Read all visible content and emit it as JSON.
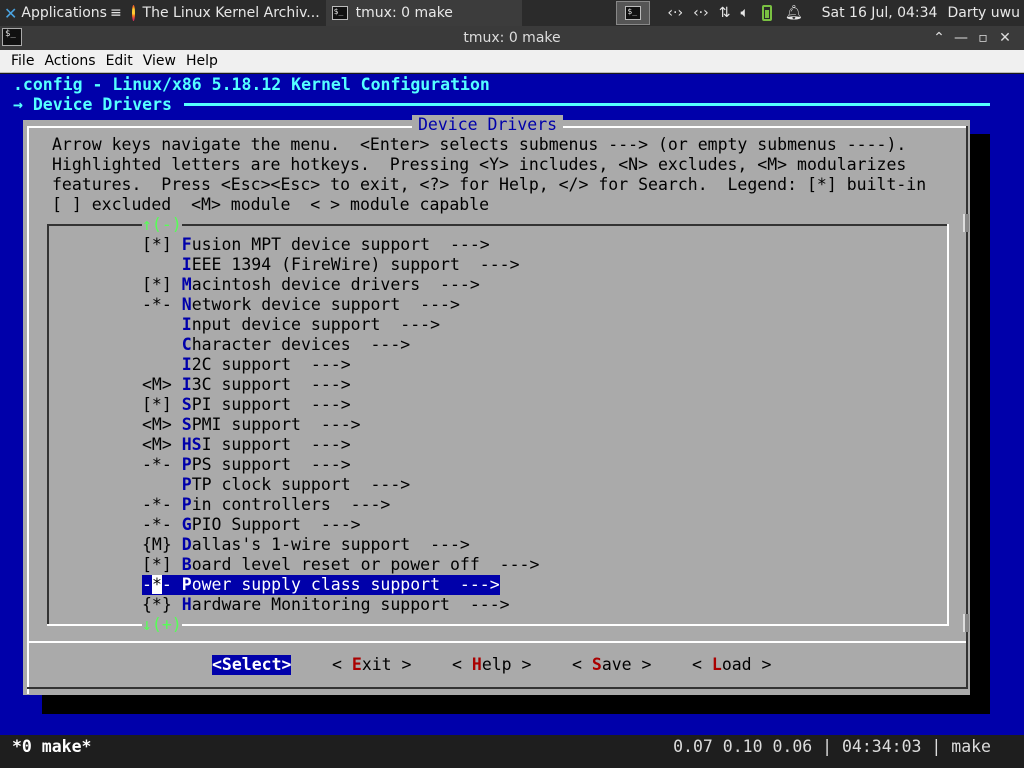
{
  "panel": {
    "apps_label": "Applications",
    "apps_suffix": "≡",
    "tasks": [
      {
        "label": "The Linux Kernel Archiv...",
        "icon": "firefox-icon"
      },
      {
        "label": "tmux: 0 make",
        "icon": "terminal-icon"
      }
    ],
    "clock": "Sat 16 Jul, 04:34",
    "user": "Darty uwu"
  },
  "window": {
    "title": "tmux: 0 make"
  },
  "menubar": {
    "items": [
      "File",
      "Actions",
      "Edit",
      "View",
      "Help"
    ]
  },
  "terminal": {
    "header_title": ".config - Linux/x86 5.18.12 Kernel Configuration",
    "breadcrumb": "→ Device Drivers",
    "dialog_title": "Device Drivers",
    "help_lines": [
      "Arrow keys navigate the menu.  <Enter> selects submenus ---> (or empty submenus ----).",
      "Highlighted letters are hotkeys.  Pressing <Y> includes, <N> excludes, <M> modularizes",
      "features.  Press <Esc><Esc> to exit, <?> for Help, </> for Search.  Legend: [*] built-in",
      "[ ] excluded  <M> module  < > module capable"
    ],
    "scroll_up": "↑(-)",
    "scroll_down": "↓(+)",
    "menu_items": [
      {
        "state": "[*]",
        "hot": "F",
        "rest": "usion MPT device support  --->"
      },
      {
        "state": "   ",
        "hot": "I",
        "rest": "EEE 1394 (FireWire) support  --->"
      },
      {
        "state": "[*]",
        "hot": "M",
        "rest": "acintosh device drivers  --->"
      },
      {
        "state": "-*-",
        "hot": "N",
        "rest": "etwork device support  --->"
      },
      {
        "state": "   ",
        "hot": "I",
        "rest": "nput device support  --->"
      },
      {
        "state": "   ",
        "hot": "C",
        "rest": "haracter devices  --->"
      },
      {
        "state": "   ",
        "hot": "I",
        "rest": "2C support  --->"
      },
      {
        "state": "<M>",
        "hot": "I",
        "rest": "3C support  --->"
      },
      {
        "state": "[*]",
        "hot": "S",
        "rest": "PI support  --->"
      },
      {
        "state": "<M>",
        "hot": "S",
        "rest": "PMI support  --->"
      },
      {
        "state": "<M>",
        "hot": "HS",
        "rest": "I support  --->"
      },
      {
        "state": "-*-",
        "hot": "P",
        "rest": "PS support  --->"
      },
      {
        "state": "   ",
        "hot": "P",
        "rest": "TP clock support  --->"
      },
      {
        "state": "-*-",
        "hot": "P",
        "rest": "in controllers  --->"
      },
      {
        "state": "-*-",
        "hot": "G",
        "rest": "PIO Support  --->"
      },
      {
        "state": "{M}",
        "hot": "D",
        "rest": "allas's 1-wire support  --->"
      },
      {
        "state": "[*]",
        "hot": "B",
        "rest": "oard level reset or power off  --->"
      },
      {
        "state": "-*-",
        "hot": "P",
        "rest": "ower supply class support  --->",
        "selected": true
      },
      {
        "state": "{*}",
        "hot": "H",
        "rest": "ardware Monitoring support  --->"
      }
    ],
    "buttons": {
      "select": "<Select>",
      "exit": [
        "< ",
        "E",
        "xit >"
      ],
      "help": [
        "< ",
        "H",
        "elp >"
      ],
      "save": [
        "< ",
        "S",
        "ave >"
      ],
      "load": [
        "< ",
        "L",
        "oad >"
      ]
    }
  },
  "status": {
    "left": "*0 make*",
    "right": "0.07 0.10 0.06 | 04:34:03 | make"
  }
}
